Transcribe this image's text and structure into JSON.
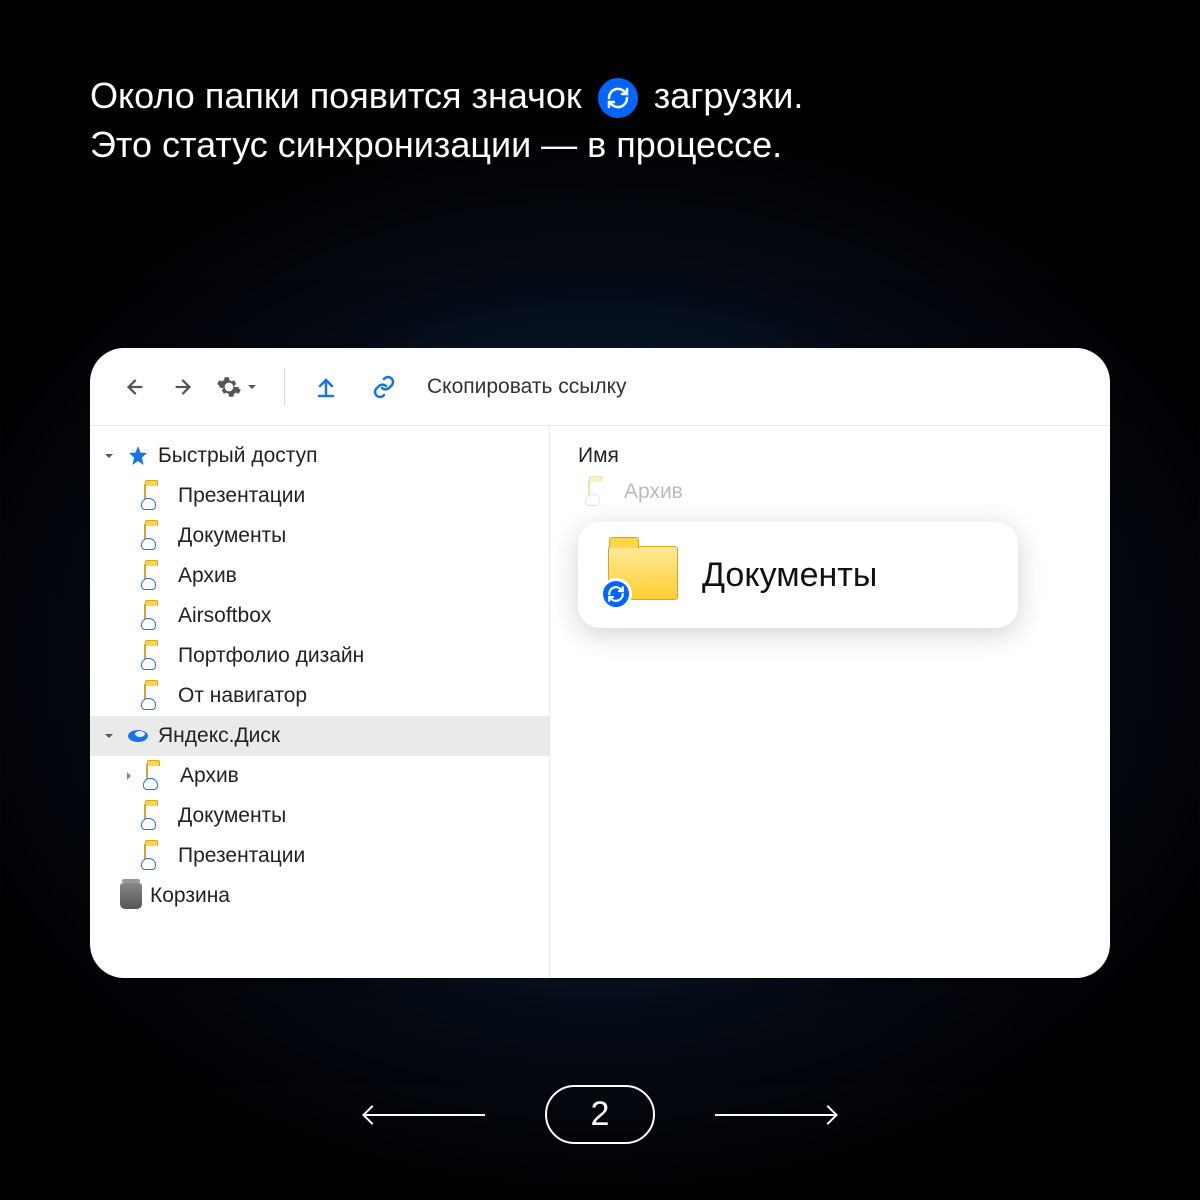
{
  "caption": {
    "part1": "Около папки появится значок",
    "part2": "загрузки.",
    "line2": "Это статус синхронизации — в процессе."
  },
  "toolbar": {
    "copy_link_label": "Скопировать ссылку"
  },
  "sidebar": {
    "quick_access": "Быстрый доступ",
    "quick_items": [
      "Презентации",
      "Документы",
      "Архив",
      "Airsoftbox",
      "Портфолио дизайн",
      "От навигатор"
    ],
    "yandex_disk": "Яндекс.Диск",
    "disk_items": [
      "Архив",
      "Документы",
      "Презентации"
    ],
    "trash": "Корзина"
  },
  "main": {
    "column_header": "Имя",
    "ghost_item": "Архив",
    "highlighted_folder": "Документы"
  },
  "pager": {
    "page": "2"
  }
}
